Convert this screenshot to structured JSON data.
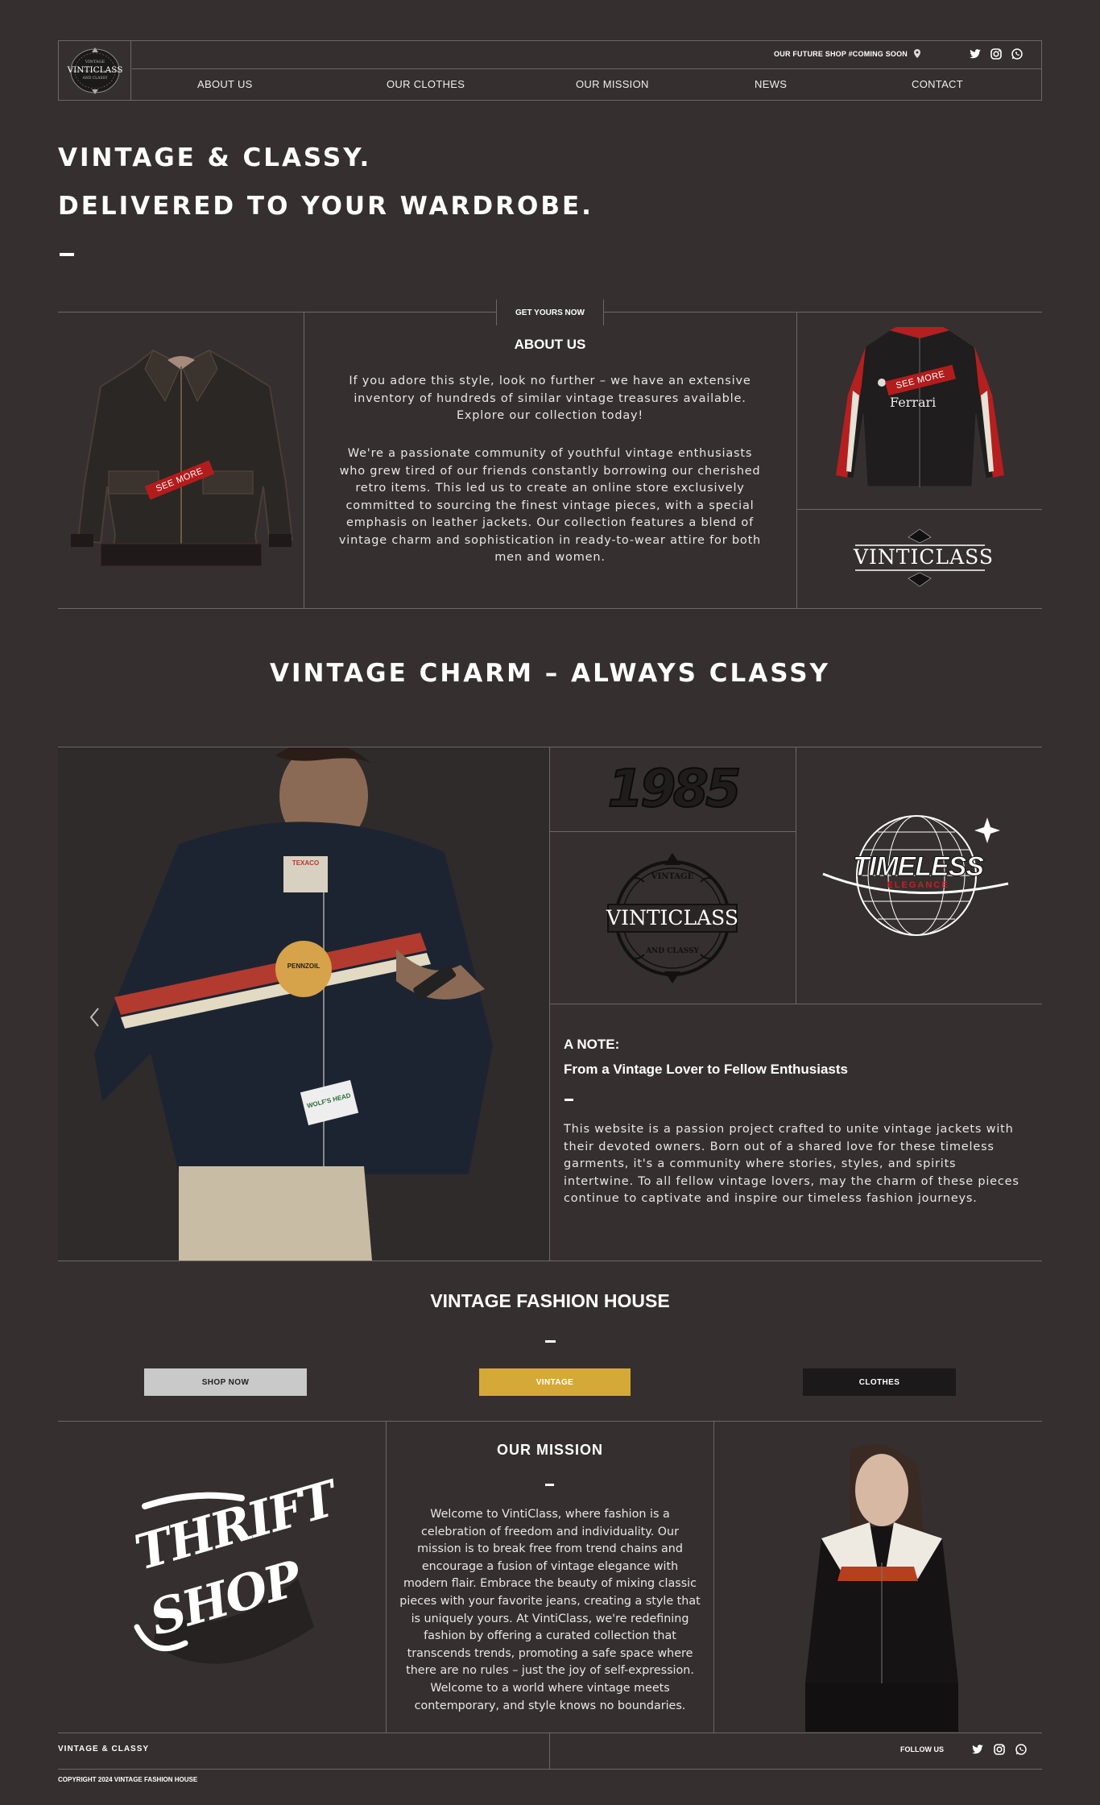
{
  "header": {
    "logo": {
      "top": "VINTAGE",
      "main": "VINTICLASS",
      "bottom": "AND CLASSY"
    },
    "future_shop": "OUR FUTURE SHOP #COMING SOON",
    "nav": [
      {
        "label": "ABOUT US"
      },
      {
        "label": "OUR CLOTHES"
      },
      {
        "label": "OUR MISSION"
      },
      {
        "label": "NEWS"
      },
      {
        "label": "CONTACT"
      }
    ],
    "social_icons": [
      "twitter-icon",
      "instagram-icon",
      "whatsapp-icon"
    ]
  },
  "hero": {
    "line1": "VINTAGE & CLASSY.",
    "line2": "DELIVERED TO YOUR WARDROBE."
  },
  "about": {
    "tab_label": "GET YOURS NOW",
    "title": "ABOUT US",
    "paragraph1": "If you adore this style, look no further – we have an extensive inventory of hundreds of similar vintage treasures available. Explore our collection today!",
    "paragraph2": "We're a passionate community of youthful vintage enthusiasts who grew tired of our friends constantly borrowing our cherished retro items. This led us to create an online store exclusively committed to sourcing the finest vintage pieces, with a special emphasis on leather jackets. Our collection features a blend of vintage charm and sophistication in ready-to-wear attire for both men and women.",
    "see_more_left": "SEE MORE",
    "see_more_right": "SEE MORE",
    "jacket_text": "Ferrari",
    "brand_wordmark": "VINTICLASS"
  },
  "charm": {
    "title": "VINTAGE CHARM – ALWAYS CLASSY",
    "badge_1985": "1985",
    "emblem": {
      "top": "VINTAGE",
      "main": "VINTICLASS",
      "bottom": "AND CLASSY"
    },
    "timeless": {
      "main": "TIMELESS",
      "sub": "ELEGANCE"
    },
    "model_patches": [
      "TEXACO",
      "PENNZOIL",
      "WOLF'S HEAD"
    ]
  },
  "note": {
    "title": "A NOTE:",
    "subtitle": "From a Vintage Lover to Fellow Enthusiasts",
    "text": "This website is a passion project crafted to unite vintage jackets with their devoted owners. Born out of a shared love for these timeless garments, it's a community where stories, styles, and spirits intertwine. To all fellow vintage lovers, may the charm of these pieces continue to captivate and inspire our timeless fashion journeys."
  },
  "house": {
    "title": "VINTAGE FASHION HOUSE",
    "buttons": [
      {
        "label": "SHOP NOW",
        "color": "#c9c9c9"
      },
      {
        "label": "VINTAGE",
        "color": "#d4a938"
      },
      {
        "label": "CLOTHES",
        "color": "#1b1919"
      }
    ]
  },
  "mission": {
    "title": "OUR MISSION",
    "text": "Welcome to VintiClass, where fashion is a celebration of freedom and individuality. Our mission is to break free from trend chains and encourage a fusion of vintage elegance with modern flair. Embrace the beauty of mixing classic pieces with your favorite jeans, creating a style that is uniquely yours. At VintiClass, we're redefining fashion by offering a curated collection that transcends trends, promoting a safe space where there are no rules – just the joy of self-expression. Welcome to a world where vintage meets contemporary, and style knows no boundaries.",
    "thrift_logo": {
      "line1": "THRIFT",
      "line2": "SHOP"
    }
  },
  "footer": {
    "brand": "VINTAGE & CLASSY",
    "follow": "FOLLOW US",
    "copyright": "COPYRIGHT 2024 VINTAGE FASHION HOUSE"
  },
  "colors": {
    "background": "#352f2f",
    "line": "#6e6767",
    "accent_red": "#b31c1c",
    "accent_gold": "#d4a938"
  }
}
